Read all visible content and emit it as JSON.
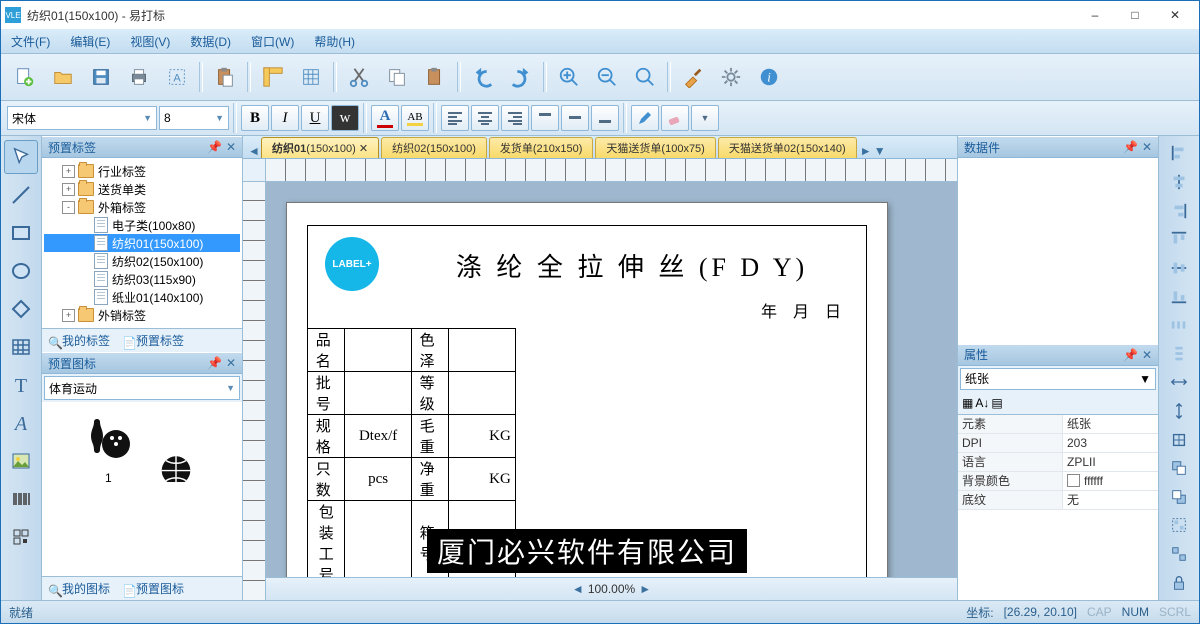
{
  "title": "纺织01(150x100) - 易打标",
  "app_icon_text": "VLE",
  "menus": [
    "文件(F)",
    "编辑(E)",
    "视图(V)",
    "数据(D)",
    "窗口(W)",
    "帮助(H)"
  ],
  "font_combo": "宋体",
  "size_combo": "8",
  "left_panels": {
    "preset_labels_title": "预置标签",
    "tree": {
      "root1": "行业标签",
      "root2": "送货单类",
      "root3": "外箱标签",
      "children3": [
        {
          "label": "电子类(100x80)",
          "sel": false
        },
        {
          "label": "纺织01(150x100)",
          "sel": true
        },
        {
          "label": "纺织02(150x100)",
          "sel": false
        },
        {
          "label": "纺织03(115x90)",
          "sel": false
        },
        {
          "label": "纸业01(140x100)",
          "sel": false
        }
      ],
      "root4": "外销标签"
    },
    "my_labels": "我的标签",
    "preset_labels_link": "预置标签",
    "preset_icons_title": "预置图标",
    "icon_category": "体育运动",
    "glyph1_caption": "1",
    "my_icons": "我的图标",
    "preset_icons_link": "预置图标"
  },
  "doctabs": [
    {
      "label": "纺织01",
      "size": "(150x100)",
      "active": true
    },
    {
      "label": "纺织02",
      "size": "(150x100)",
      "active": false
    },
    {
      "label": "发货单",
      "size": "(210x150)",
      "active": false
    },
    {
      "label": "天猫送货单",
      "size": "(100x75)",
      "active": false
    },
    {
      "label": "天猫送货单02",
      "size": "(150x140)",
      "active": false
    }
  ],
  "label_design": {
    "logo_text": "LABEL+",
    "title": "涤 纶 全 拉 伸 丝   (F D Y)",
    "date_row": "年    月    日",
    "rows": [
      {
        "a": "品 名",
        "b": "",
        "c": "色 泽",
        "d": ""
      },
      {
        "a": "批 号",
        "b": "",
        "c": "等 级",
        "d": ""
      },
      {
        "a": "规 格",
        "b": "Dtex/f",
        "c": "毛 重",
        "d": "KG"
      },
      {
        "a": "只 数",
        "b": "pcs",
        "c": "净 重",
        "d": "KG"
      },
      {
        "a": "包装工号",
        "b": "",
        "c": "箱 号",
        "d": ""
      }
    ],
    "footer": "厦门必兴软件有限公司"
  },
  "zoom": "100.00%",
  "right_panels": {
    "datafile_title": "数据件",
    "props_title": "属性",
    "prop_combo": "纸张",
    "rows": [
      {
        "k": "元素",
        "v": "纸张"
      },
      {
        "k": "DPI",
        "v": "203"
      },
      {
        "k": "语言",
        "v": "ZPLII"
      },
      {
        "k": "背景颜色",
        "v": "ffffff",
        "swatch": true
      },
      {
        "k": "底纹",
        "v": "无"
      }
    ]
  },
  "status": {
    "ready": "就绪",
    "coord_label": "坐标:",
    "coord_value": "[26.29, 20.10]",
    "cap": "CAP",
    "num": "NUM",
    "scrl": "SCRL"
  }
}
